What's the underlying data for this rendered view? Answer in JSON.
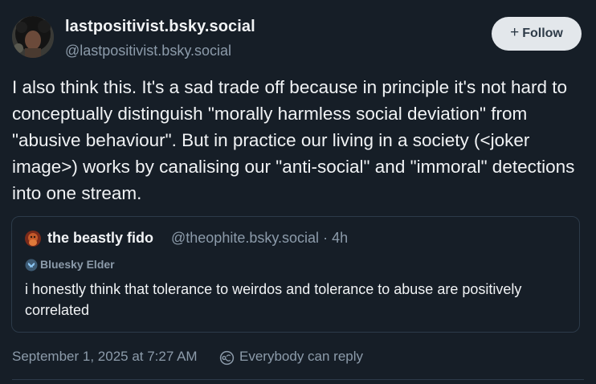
{
  "author": {
    "display_name": "lastpositivist.bsky.social",
    "handle": "@lastpositivist.bsky.social"
  },
  "follow_button": {
    "icon": "+",
    "label": "Follow"
  },
  "post": {
    "text": "I also think this. It's a sad trade off because in principle it's not hard to conceptually distinguish \"morally harmless social deviation\" from \"abusive behaviour\". But in practice our living in a society (<joker image>) works by canalising our \"anti-social\" and \"immoral\" detections into one stream."
  },
  "quote": {
    "display_name": "the beastly fido",
    "handle": "@theophite.bsky.social",
    "separator": "·",
    "age": "4h",
    "badge": "Bluesky Elder",
    "text": "i honestly think that tolerance to weirdos and tolerance to abuse are positively correlated"
  },
  "meta": {
    "timestamp": "September 1, 2025 at 7:27 AM",
    "reply_setting": "Everybody can reply"
  },
  "colors": {
    "background": "#161e27",
    "text": "#f1f3f5",
    "muted": "#8c9baa",
    "border": "#2c3a49",
    "follow_bg": "#e3e7eb"
  }
}
